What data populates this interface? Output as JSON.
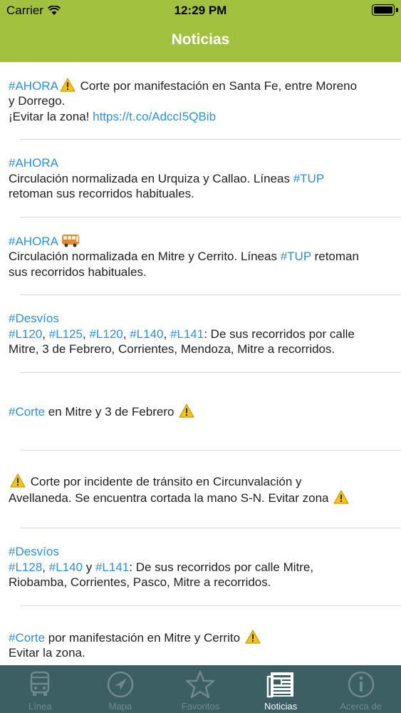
{
  "status_bar": {
    "carrier": "Carrier",
    "time": "12:29 PM",
    "battery_level": 1.0
  },
  "nav": {
    "title": "Noticias"
  },
  "colors": {
    "header": "#a2c23f",
    "link": "#2e8fdc",
    "tabbar": "#3b5f63",
    "tab_inactive": "#6f8a8c",
    "tab_active": "#ffffff"
  },
  "news": [
    {
      "lines": [
        [
          {
            "t": "#AHORA",
            "tag": true
          },
          {
            "icon": "warning-icon"
          },
          {
            "t": " Corte por manifestación en Santa Fe, entre Moreno"
          }
        ],
        [
          {
            "t": "y Dorrego."
          }
        ],
        [
          {
            "t": "¡Evitar la zona! "
          },
          {
            "t": "https://t.co/AdccI5QBib",
            "tag": true
          }
        ]
      ]
    },
    {
      "lines": [
        [
          {
            "t": "#AHORA",
            "tag": true
          }
        ],
        [
          {
            "t": "Circulación normalizada en Urquiza y Callao. Líneas "
          },
          {
            "t": "#TUP",
            "tag": true
          }
        ],
        [
          {
            "t": "retoman sus recorridos habituales."
          }
        ]
      ]
    },
    {
      "lines": [
        [
          {
            "t": "#AHORA",
            "tag": true
          },
          {
            "icon": "bus-icon"
          }
        ],
        [
          {
            "t": "Circulación normalizada en Mitre y Cerrito. Líneas "
          },
          {
            "t": "#TUP",
            "tag": true
          },
          {
            "t": " retoman"
          }
        ],
        [
          {
            "t": "sus recorridos habituales."
          }
        ]
      ]
    },
    {
      "lines": [
        [
          {
            "t": "#Desvíos",
            "tag": true
          }
        ],
        [
          {
            "t": "#L120",
            "tag": true
          },
          {
            "t": ", "
          },
          {
            "t": "#L125",
            "tag": true
          },
          {
            "t": ", "
          },
          {
            "t": "#L120",
            "tag": true
          },
          {
            "t": ", "
          },
          {
            "t": "#L140",
            "tag": true
          },
          {
            "t": ", "
          },
          {
            "t": "#L141",
            "tag": true
          },
          {
            "t": ": De sus recorridos por calle"
          }
        ],
        [
          {
            "t": "Mitre, 3 de Febrero, Corrientes, Mendoza, Mitre a recorridos."
          }
        ]
      ]
    },
    {
      "lines": [
        [
          {
            "t": "#Corte",
            "tag": true
          },
          {
            "t": " en Mitre y 3 de Febrero "
          },
          {
            "icon": "warning-icon"
          }
        ]
      ]
    },
    {
      "lines": [
        [
          {
            "icon": "warning-icon"
          },
          {
            "t": " Corte por incidente de tránsito en Circunvalación y"
          }
        ],
        [
          {
            "t": "Avellaneda. Se encuentra cortada la mano S-N. Evitar zona "
          },
          {
            "icon": "warning-icon"
          }
        ]
      ]
    },
    {
      "lines": [
        [
          {
            "t": "#Desvíos",
            "tag": true
          }
        ],
        [
          {
            "t": "#L128",
            "tag": true
          },
          {
            "t": ", "
          },
          {
            "t": "#L140",
            "tag": true
          },
          {
            "t": " y "
          },
          {
            "t": "#L141",
            "tag": true
          },
          {
            "t": ": De sus recorridos por calle Mitre,"
          }
        ],
        [
          {
            "t": "Riobamba, Corrientes, Pasco, Mitre a recorridos."
          }
        ]
      ]
    },
    {
      "lines": [
        [
          {
            "t": "#Corte",
            "tag": true
          },
          {
            "t": " por manifestación en Mitre y Cerrito "
          },
          {
            "icon": "warning-icon"
          }
        ],
        [
          {
            "t": "Evitar la zona."
          }
        ]
      ]
    }
  ],
  "tabs": [
    {
      "label": "Línea",
      "icon": "bus-icon",
      "active": false
    },
    {
      "label": "Mapa",
      "icon": "compass-icon",
      "active": false
    },
    {
      "label": "Favoritos",
      "icon": "star-icon",
      "active": false
    },
    {
      "label": "Noticias",
      "icon": "newspaper-icon",
      "active": true
    },
    {
      "label": "Acerca de",
      "icon": "info-icon",
      "active": false
    }
  ]
}
